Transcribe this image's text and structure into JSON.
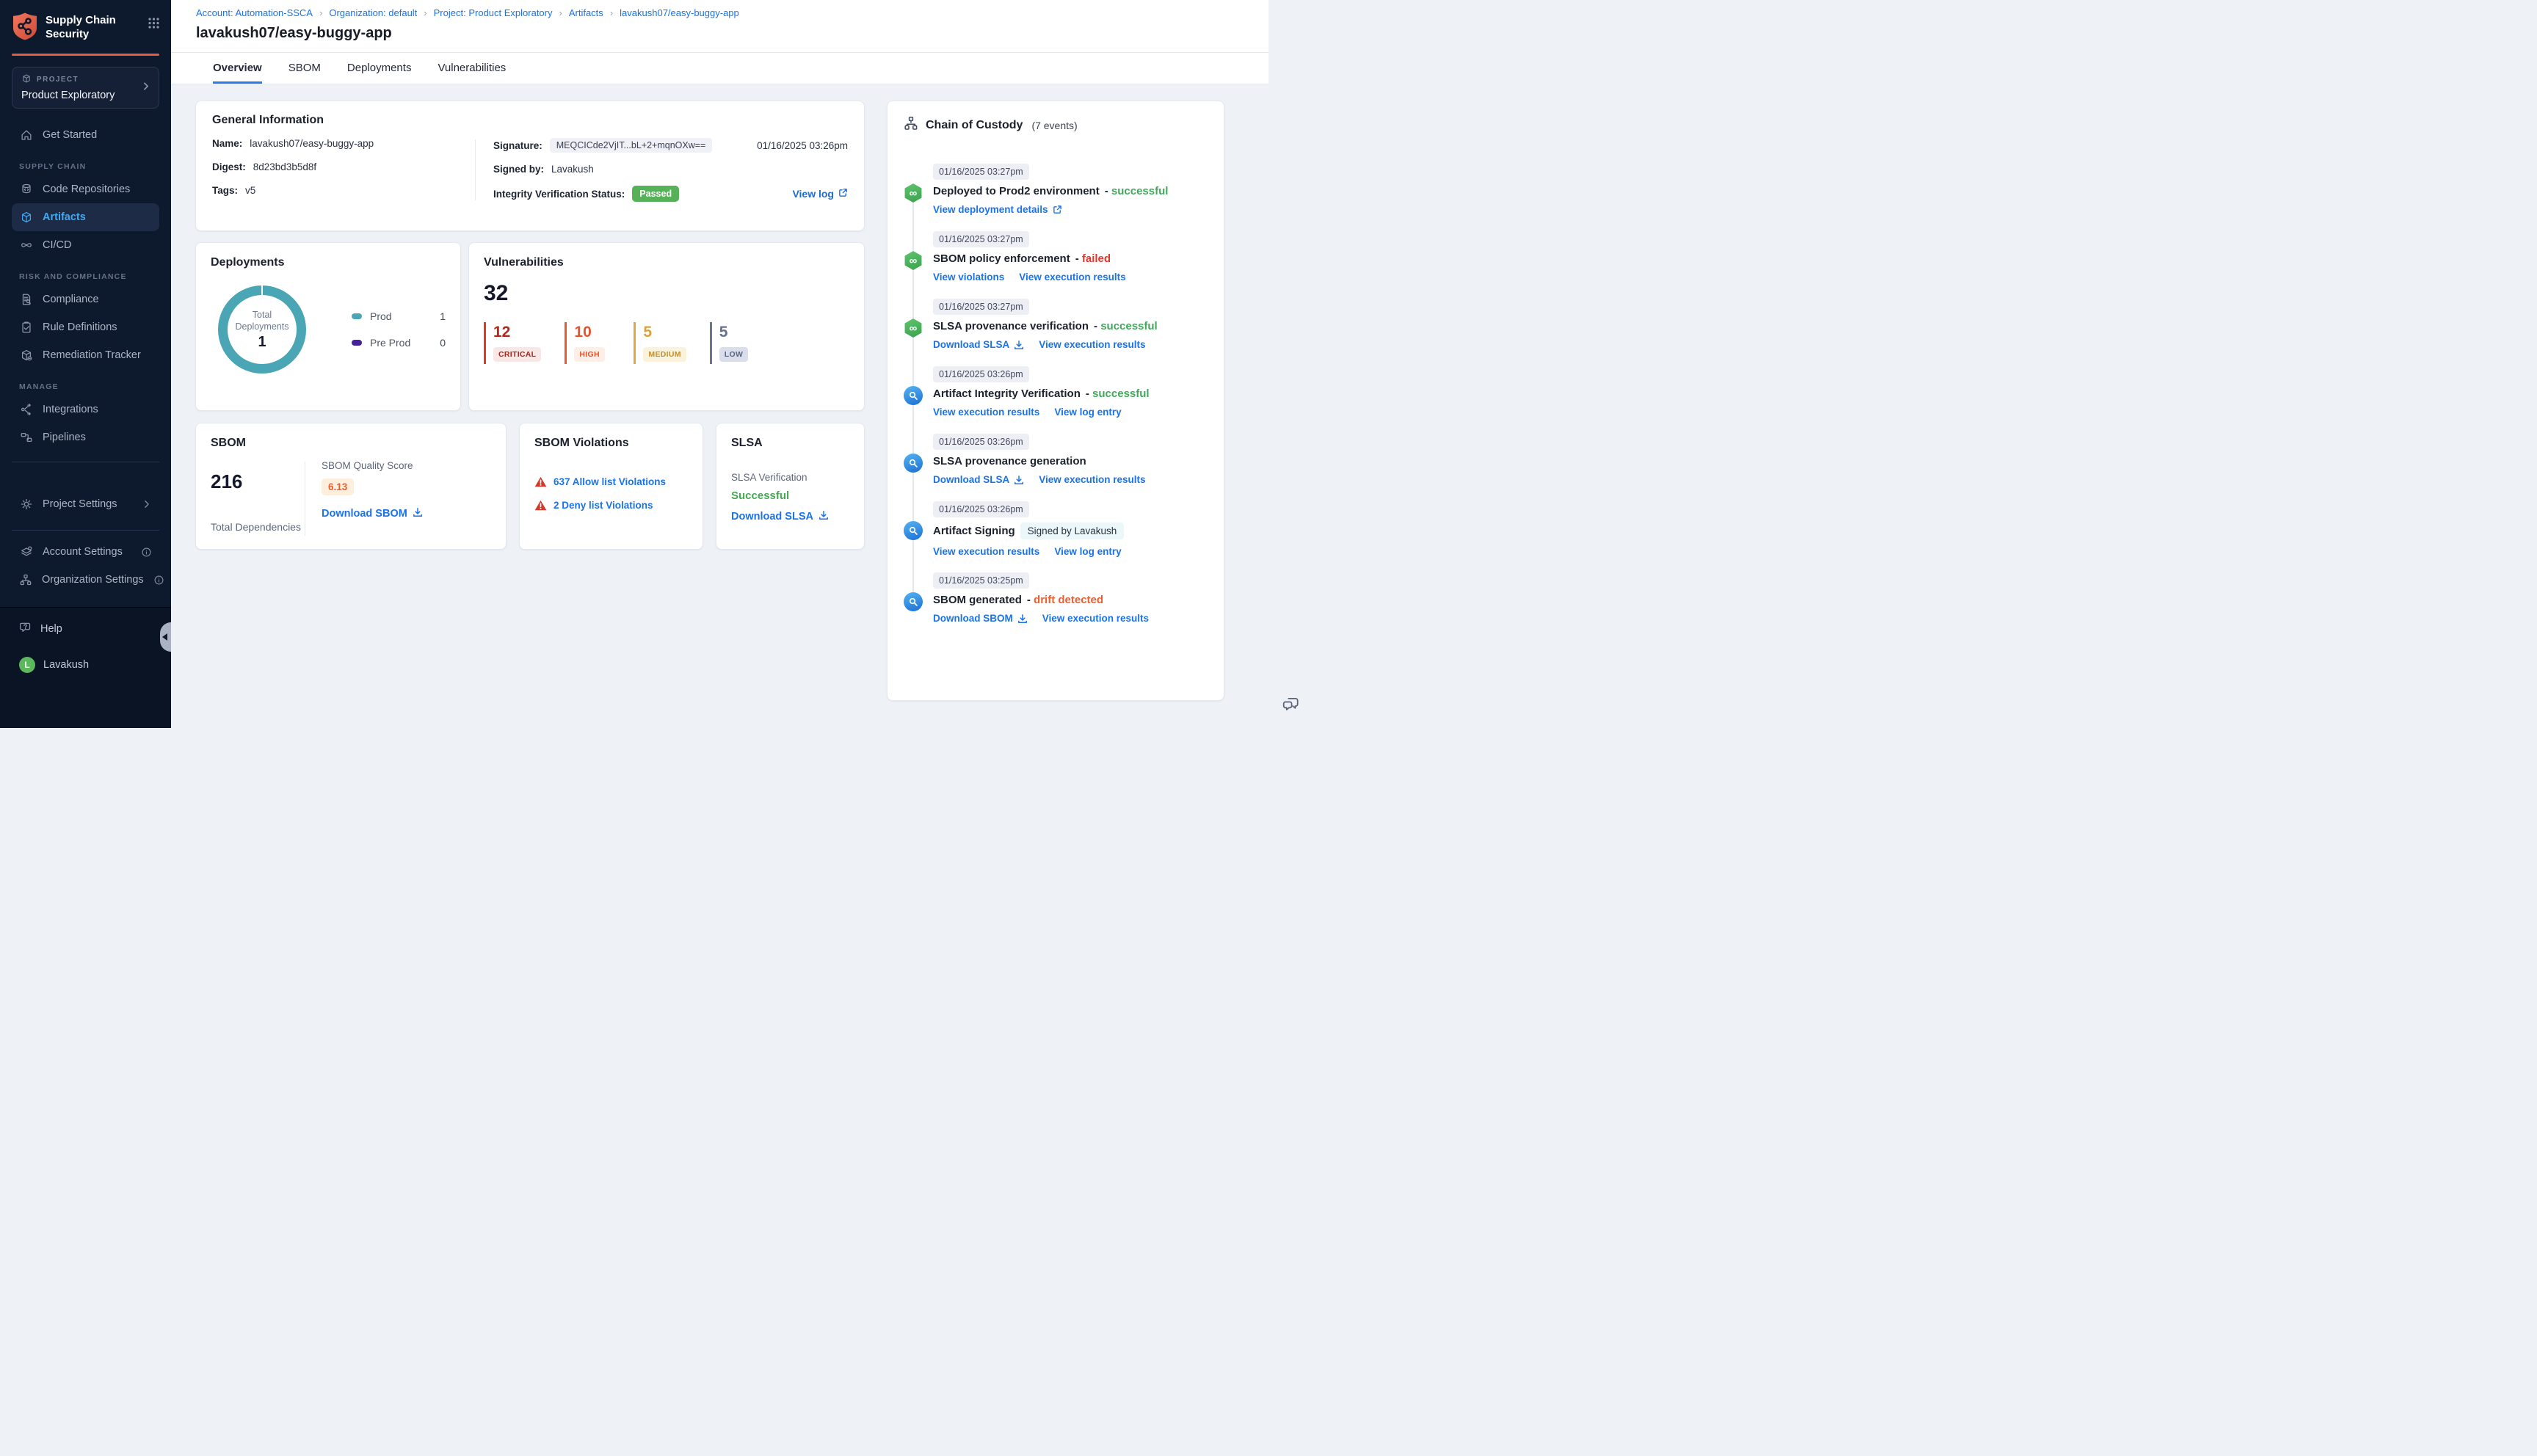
{
  "brand": {
    "title": "Supply Chain Security",
    "logo_icon": "shield-branch-icon",
    "apps_icon": "grid-icon",
    "accent_color": "#e45b41"
  },
  "project_selector": {
    "eyebrow": "PROJECT",
    "name": "Product Exploratory",
    "icon": "cube-icon"
  },
  "sidebar": {
    "items": [
      {
        "type": "item",
        "label": "Get Started",
        "icon": "home-icon"
      },
      {
        "type": "section",
        "label": "SUPPLY CHAIN"
      },
      {
        "type": "item",
        "label": "Code Repositories",
        "icon": "repository-icon"
      },
      {
        "type": "item",
        "label": "Artifacts",
        "icon": "cube-icon",
        "active": true
      },
      {
        "type": "item",
        "label": "CI/CD",
        "icon": "infinity-icon"
      },
      {
        "type": "section",
        "label": "RISK AND COMPLIANCE"
      },
      {
        "type": "item",
        "label": "Compliance",
        "icon": "document-search-icon"
      },
      {
        "type": "item",
        "label": "Rule Definitions",
        "icon": "clipboard-check-icon"
      },
      {
        "type": "item",
        "label": "Remediation Tracker",
        "icon": "box-wrench-icon"
      },
      {
        "type": "section",
        "label": "MANAGE"
      },
      {
        "type": "item",
        "label": "Integrations",
        "icon": "share-nodes-icon"
      },
      {
        "type": "item",
        "label": "Pipelines",
        "icon": "pipeline-icon"
      }
    ],
    "settings_items": [
      {
        "label": "Project Settings",
        "icon": "gear-icon",
        "trail": "chevron-right-icon"
      },
      {
        "label": "Account Settings",
        "icon": "layers-gear-icon",
        "trail": "info-icon"
      },
      {
        "label": "Organization Settings",
        "icon": "org-gear-icon",
        "trail": "info-icon"
      }
    ],
    "footer": {
      "help_label": "Help",
      "help_icon": "chat-question-icon",
      "user_name": "Lavakush",
      "avatar_letter": "L",
      "avatar_color": "#5cb85c"
    }
  },
  "breadcrumb": {
    "separator": "›",
    "items": [
      "Account: Automation-SSCA",
      "Organization: default",
      "Project: Product Exploratory",
      "Artifacts",
      "lavakush07/easy-buggy-app"
    ]
  },
  "page": {
    "title": "lavakush07/easy-buggy-app"
  },
  "tabs": [
    {
      "label": "Overview",
      "active": true
    },
    {
      "label": "SBOM"
    },
    {
      "label": "Deployments"
    },
    {
      "label": "Vulnerabilities"
    }
  ],
  "general_info": {
    "title": "General Information",
    "name_label": "Name:",
    "name_value": "lavakush07/easy-buggy-app",
    "digest_label": "Digest:",
    "digest_value": "8d23bd3b5d8f",
    "tags_label": "Tags:",
    "tags_value": "v5",
    "signature_label": "Signature:",
    "signature_value": "MEQCICde2VjIT...bL+2+mqnOXw==",
    "signature_time": "01/16/2025 03:26pm",
    "signed_by_label": "Signed by:",
    "signed_by_value": "Lavakush",
    "integrity_label": "Integrity Verification Status:",
    "integrity_status": "Passed",
    "integrity_badge_color": "#57b158",
    "view_log_label": "View log"
  },
  "deployments": {
    "title": "Deployments",
    "chart_data": {
      "type": "pie",
      "center_label": "Total Deployments",
      "total": "1",
      "series": [
        {
          "label": "Prod",
          "value": 1,
          "color": "#4aa6b4"
        },
        {
          "label": "Pre Prod",
          "value": 0,
          "color": "#45219a"
        }
      ]
    }
  },
  "vulnerabilities": {
    "title": "Vulnerabilities",
    "total": "32",
    "severities": [
      {
        "count": "12",
        "label": "CRITICAL",
        "number_color": "#b3271d",
        "bar_color": "#e23a22",
        "badge_bg": "#f9e7e5",
        "badge_text": "#a8281c"
      },
      {
        "count": "10",
        "label": "HIGH",
        "number_color": "#e8522c",
        "bar_color": "#ea5a2e",
        "badge_bg": "#fdeee6",
        "badge_text": "#e8522c"
      },
      {
        "count": "5",
        "label": "MEDIUM",
        "number_color": "#d9a23a",
        "bar_color": "#dfa93f",
        "badge_bg": "#faf2da",
        "badge_text": "#c08f2e"
      },
      {
        "count": "5",
        "label": "LOW",
        "number_color": "#667092",
        "bar_color": "#6b7492",
        "badge_bg": "#dadeea",
        "badge_text": "#5b6583"
      }
    ]
  },
  "sbom": {
    "title": "SBOM",
    "total": "216",
    "total_label": "Total Dependencies",
    "quality_label": "SBOM Quality Score",
    "quality_value": "6.13",
    "quality_badge_bg": "#fdeede",
    "quality_text_color": "#e8602f",
    "download_label": "Download SBOM"
  },
  "sbom_violations": {
    "title": "SBOM Violations",
    "items": [
      {
        "label": "637 Allow list Violations"
      },
      {
        "label": "2 Deny list Violations"
      }
    ]
  },
  "slsa": {
    "title": "SLSA",
    "verification_label": "SLSA Verification",
    "status": "Successful",
    "status_color": "#44a952",
    "download_label": "Download SLSA"
  },
  "chain_of_custody": {
    "title": "Chain of Custody",
    "count_label": "(7 events)",
    "header_icon": "hierarchy-icon",
    "events": [
      {
        "time": "01/16/2025 03:27pm",
        "icon": "cd-module-icon",
        "title": "Deployed to Prod2 environment",
        "status": "successful",
        "status_color": "#42a85c",
        "links": [
          {
            "label": "View deployment details",
            "icon": "external-link-icon"
          }
        ]
      },
      {
        "time": "01/16/2025 03:27pm",
        "icon": "cd-module-icon",
        "title": "SBOM policy enforcement",
        "status": "failed",
        "status_color": "#e0362c",
        "links": [
          {
            "label": "View violations"
          },
          {
            "label": "View execution results"
          }
        ]
      },
      {
        "time": "01/16/2025 03:27pm",
        "icon": "cd-module-icon",
        "title": "SLSA provenance verification",
        "status": "successful",
        "status_color": "#42a85c",
        "links": [
          {
            "label": "Download SLSA",
            "icon": "download-icon"
          },
          {
            "label": "View execution results"
          }
        ]
      },
      {
        "time": "01/16/2025 03:26pm",
        "icon": "scs-module-icon",
        "title": "Artifact Integrity Verification",
        "status": "successful",
        "status_color": "#42a85c",
        "links": [
          {
            "label": "View execution results"
          },
          {
            "label": "View log entry"
          }
        ]
      },
      {
        "time": "01/16/2025 03:26pm",
        "icon": "scs-module-icon",
        "title": "SLSA provenance generation",
        "links": [
          {
            "label": "Download SLSA",
            "icon": "download-icon"
          },
          {
            "label": "View execution results"
          }
        ]
      },
      {
        "time": "01/16/2025 03:26pm",
        "icon": "scs-module-icon",
        "title": "Artifact Signing",
        "badge": "Signed by Lavakush",
        "links": [
          {
            "label": "View execution results"
          },
          {
            "label": "View log entry"
          }
        ]
      },
      {
        "time": "01/16/2025 03:25pm",
        "icon": "scs-module-icon",
        "title": "SBOM generated",
        "status": "drift detected",
        "status_color": "#ed5e2f",
        "links": [
          {
            "label": "Download SBOM",
            "icon": "download-icon"
          },
          {
            "label": "View execution results"
          }
        ]
      }
    ]
  },
  "feedback_icon": "chat-bubbles-icon"
}
